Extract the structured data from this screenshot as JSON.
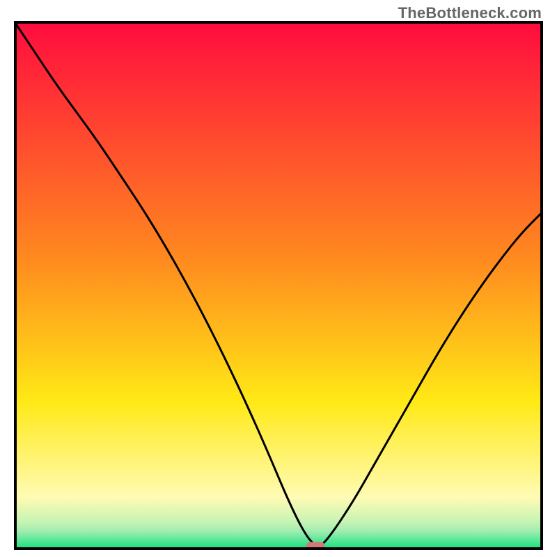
{
  "watermark": {
    "text": "TheBottleneck.com"
  },
  "colors": {
    "top": "#ff0b3e",
    "orange": "#ff8a1f",
    "yellow": "#ffe916",
    "paleYellow": "#fffbb3",
    "softGreenA": "#c9f4b4",
    "softGreenB": "#9eedb0",
    "green": "#0be07a",
    "frame": "#000000",
    "curve": "#000000",
    "marker": "#d47a76"
  },
  "chart_data": {
    "type": "line",
    "title": "",
    "xlabel": "",
    "ylabel": "",
    "xlim": [
      0,
      100
    ],
    "ylim": [
      0,
      100
    ],
    "grid": false,
    "series": [
      {
        "name": "bottleneck-curve",
        "x": [
          0,
          4,
          8,
          12,
          16,
          20,
          24,
          28,
          32,
          36,
          40,
          44,
          48,
          52,
          55,
          57,
          58,
          60,
          64,
          68,
          72,
          76,
          80,
          84,
          88,
          92,
          96,
          100
        ],
        "y": [
          100,
          94,
          88,
          82.5,
          77,
          71,
          65,
          58.5,
          51.5,
          44,
          36,
          27.5,
          18.5,
          9,
          3,
          0.7,
          0.7,
          3,
          9,
          16,
          23,
          30,
          37,
          43.5,
          49.5,
          55,
          60,
          64
        ]
      }
    ],
    "marker": {
      "x": 57,
      "width": 3.5,
      "height": 1.4
    }
  },
  "gradient_stops": [
    {
      "offset": 0.0,
      "key": "top"
    },
    {
      "offset": 0.45,
      "key": "orange"
    },
    {
      "offset": 0.72,
      "key": "yellow"
    },
    {
      "offset": 0.9,
      "key": "paleYellow"
    },
    {
      "offset": 0.945,
      "key": "softGreenA"
    },
    {
      "offset": 0.965,
      "key": "softGreenB"
    },
    {
      "offset": 1.0,
      "key": "green"
    }
  ]
}
